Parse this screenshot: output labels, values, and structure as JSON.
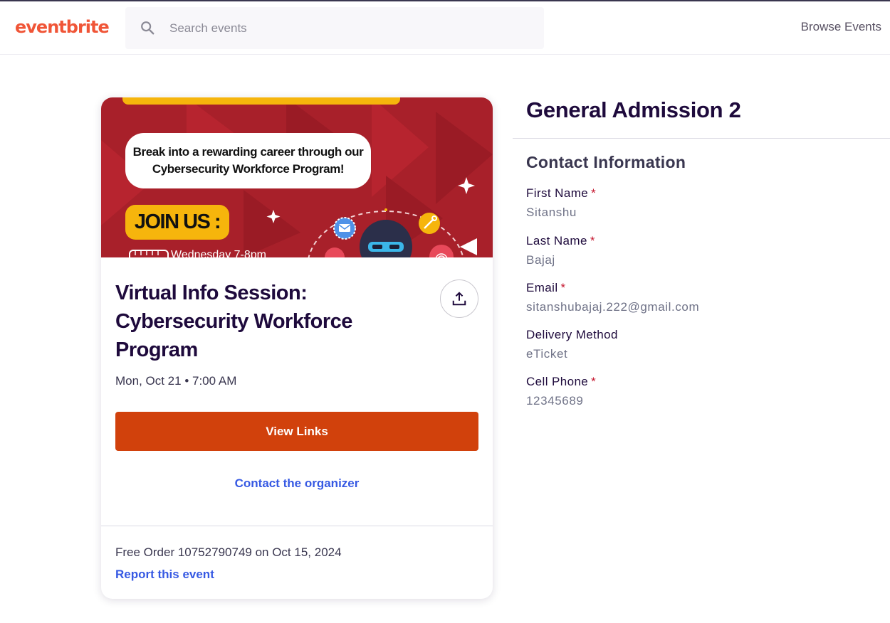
{
  "header": {
    "logo": "eventbrite",
    "search_placeholder": "Search events",
    "browse_label": "Browse Events"
  },
  "event": {
    "banner": {
      "bubble_text": "Break into a rewarding career through our Cybersecurity Workforce Program!",
      "join_text": "JOIN US :",
      "date_text": "Wednesday 7-8pm"
    },
    "title": "Virtual Info Session: Cybersecurity Workforce Program",
    "date": "Mon, Oct 21 • 7:00 AM",
    "view_links_label": "View Links",
    "contact_label": "Contact the organizer",
    "order_text": "Free Order 10752790749 on Oct 15, 2024",
    "report_label": "Report this event"
  },
  "ticket": {
    "title": "General Admission 2",
    "section_title": "Contact Information",
    "fields": [
      {
        "label": "First Name",
        "required": "*",
        "value": "Sitanshu"
      },
      {
        "label": "Last Name",
        "required": "*",
        "value": "Bajaj"
      },
      {
        "label": "Email",
        "required": "*",
        "value": "sitanshubajaj.222@gmail.com"
      },
      {
        "label": "Delivery Method",
        "required": "",
        "value": "eTicket"
      },
      {
        "label": "Cell Phone",
        "required": "*",
        "value": "12345689"
      }
    ]
  },
  "colors": {
    "brand": "#f05537",
    "primary_button": "#d1410c",
    "link": "#3659e3",
    "required": "#c5162e",
    "banner_red": "#a8202a",
    "banner_yellow": "#f6b50c"
  },
  "icons": [
    "search-icon",
    "share-icon",
    "calendar-icon",
    "sparkle-icon",
    "envelope-icon",
    "key-icon",
    "fingerprint-icon",
    "hacker-icon"
  ]
}
